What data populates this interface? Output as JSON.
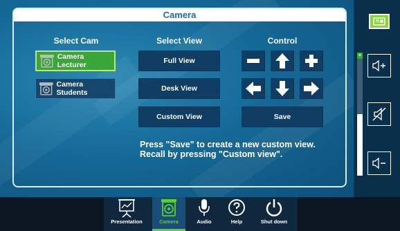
{
  "panel": {
    "title": "Camera"
  },
  "select_cam": {
    "heading": "Select Cam",
    "options": [
      {
        "label": "Camera Lecturer",
        "active": true
      },
      {
        "label": "Camera Students",
        "active": false
      }
    ]
  },
  "select_view": {
    "heading": "Select View",
    "options": [
      "Full View",
      "Desk View",
      "Custom View"
    ]
  },
  "control": {
    "heading": "Control",
    "buttons": [
      "zoom-out",
      "tilt-up",
      "zoom-in",
      "pan-left",
      "tilt-down",
      "pan-right"
    ],
    "save_label": "Save"
  },
  "help": {
    "line1": "Press \"Save\" to create a new custom view.",
    "line2": "Recall by pressing \"Custom view\"."
  },
  "volume": {
    "level": 0.5,
    "plus_label": "+"
  },
  "nav": {
    "items": [
      {
        "label": "Presentation",
        "icon": "presentation-icon",
        "active": false
      },
      {
        "label": "Camera",
        "icon": "camera-icon",
        "active": true
      },
      {
        "label": "Audio",
        "icon": "microphone-icon",
        "active": false
      },
      {
        "label": "Help",
        "icon": "help-icon",
        "active": false
      },
      {
        "label": "Shut down",
        "icon": "power-icon",
        "active": false
      }
    ]
  },
  "colors": {
    "accent_green": "#5bd12e",
    "active_green": "#3aa63a",
    "panel_blue": "#1a6f9c"
  }
}
